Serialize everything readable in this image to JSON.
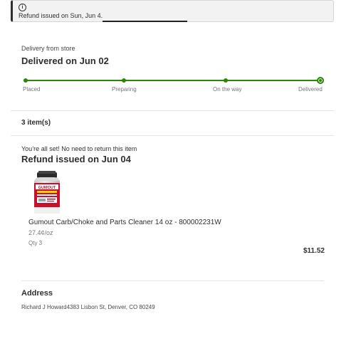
{
  "notice": {
    "icon": "info-icon",
    "message": "Refund issued on Sun, Jun 4."
  },
  "delivery": {
    "type_label": "Delivery from store",
    "status_title": "Delivered on Jun 02",
    "accent_color": "#2a8703",
    "steps": [
      {
        "label": "Placed"
      },
      {
        "label": "Preparing"
      },
      {
        "label": "On the way"
      },
      {
        "label": "Delivered"
      }
    ],
    "current_step": "Delivered"
  },
  "items": {
    "count_label": "3 item(s)"
  },
  "refund": {
    "note": "You’re all set! No need to return this item",
    "title": "Refund issued on Jun 04",
    "product": {
      "image_icon": "product-can-image",
      "name": "Gumout Carb/Choke and Parts Cleaner 14 oz - 800002231W",
      "unit_price": "27.4¢/oz",
      "qty": "Qty 3",
      "price": "$11.52"
    }
  },
  "address": {
    "title": "Address",
    "line": "Richard J Howard4383 Lisbon St, Denver, CO 80249"
  }
}
